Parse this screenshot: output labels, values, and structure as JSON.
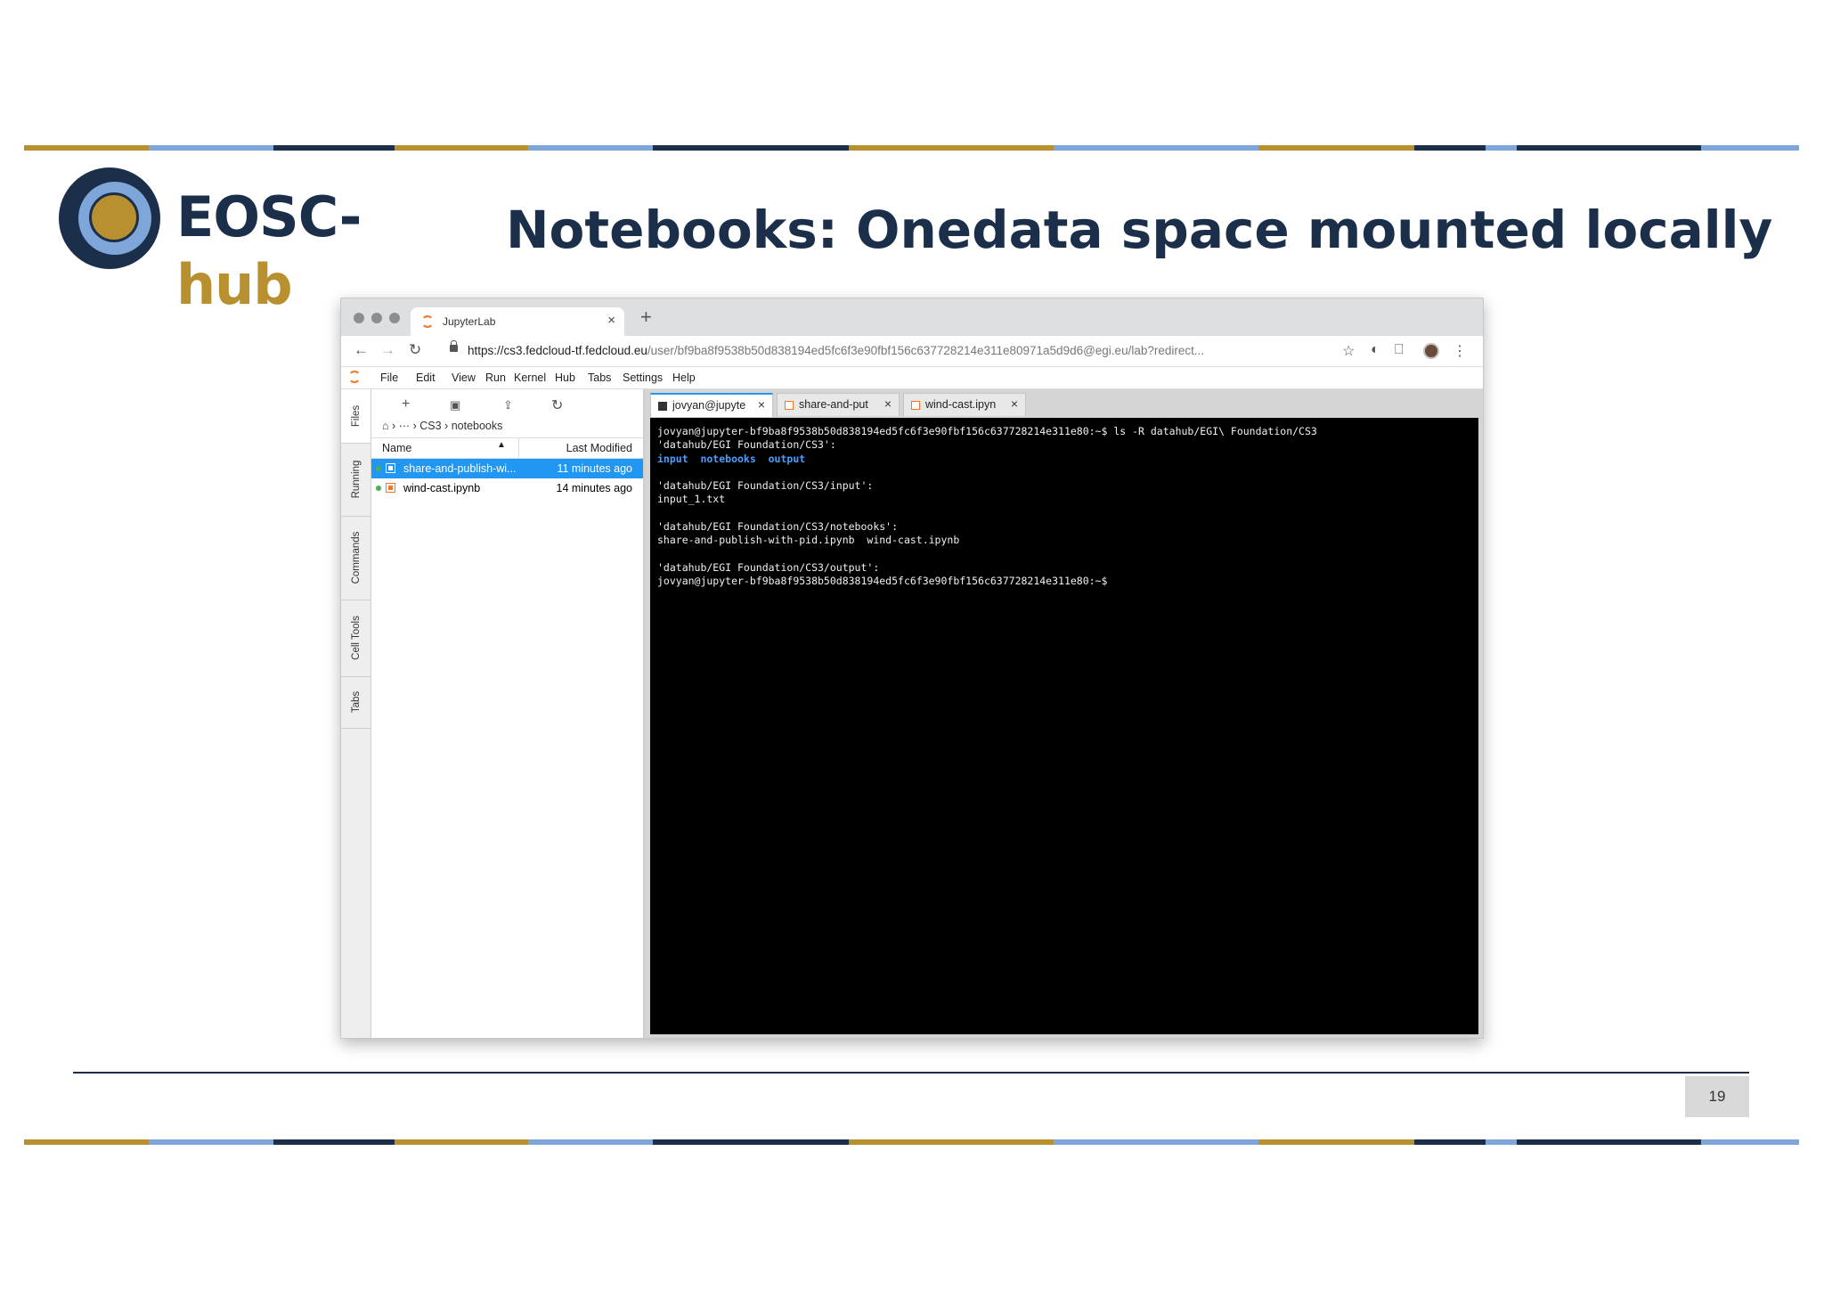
{
  "slide": {
    "logo_text_main": "EOSC-",
    "logo_text_hub": "hub",
    "title": "Notebooks: Onedata space mounted locally",
    "page_number": "19",
    "colors": {
      "navy": "#1b2f4a",
      "gold": "#b8902f",
      "light_blue": "#7ea6d8"
    }
  },
  "browser": {
    "tab_title": "JupyterLab",
    "tab_close": "×",
    "new_tab": "+",
    "url_host": "https://cs3.fedcloud-tf.fedcloud.eu",
    "url_path": "/user/bf9ba8f9538b50d838194ed5fc6f3e90fbf156c637728214e311e80971a5d9d6@egi.eu/lab?redirect...",
    "icons": [
      "back-icon",
      "forward-icon",
      "reload-icon",
      "lock-icon",
      "star-icon",
      "extension-icon",
      "bookmark-icon",
      "avatar",
      "more-icon"
    ]
  },
  "menu": [
    "File",
    "Edit",
    "View",
    "Run",
    "Kernel",
    "Hub",
    "Tabs",
    "Settings",
    "Help"
  ],
  "sidebar_tabs": [
    "Files",
    "Running",
    "Commands",
    "Cell Tools",
    "Tabs"
  ],
  "filebrowser": {
    "breadcrumb": "··· › CS3 › notebooks",
    "col_name": "Name",
    "col_modified": "Last Modified",
    "files": [
      {
        "name": "share-and-publish-wi...",
        "modified": "11 minutes ago",
        "selected": true
      },
      {
        "name": "wind-cast.ipynb",
        "modified": "14 minutes ago",
        "selected": false
      }
    ]
  },
  "doc_tabs": [
    {
      "label": "jovyan@jupyte",
      "close": "×"
    },
    {
      "label": "share-and-put",
      "close": "×"
    },
    {
      "label": "wind-cast.ipyn",
      "close": "×"
    }
  ],
  "terminal": {
    "lines": [
      "jovyan@jupyter-bf9ba8f9538b50d838194ed5fc6f3e90fbf156c637728214e311e80:~$ ls -R datahub/EGI\\ Foundation/CS3",
      "'datahub/EGI Foundation/CS3':",
      "input  notebooks  output",
      "",
      "'datahub/EGI Foundation/CS3/input':",
      "input_1.txt",
      "",
      "'datahub/EGI Foundation/CS3/notebooks':",
      "share-and-publish-with-pid.ipynb  wind-cast.ipynb",
      "",
      "'datahub/EGI Foundation/CS3/output':",
      "jovyan@jupyter-bf9ba8f9538b50d838194ed5fc6f3e90fbf156c637728214e311e80:~$"
    ]
  }
}
